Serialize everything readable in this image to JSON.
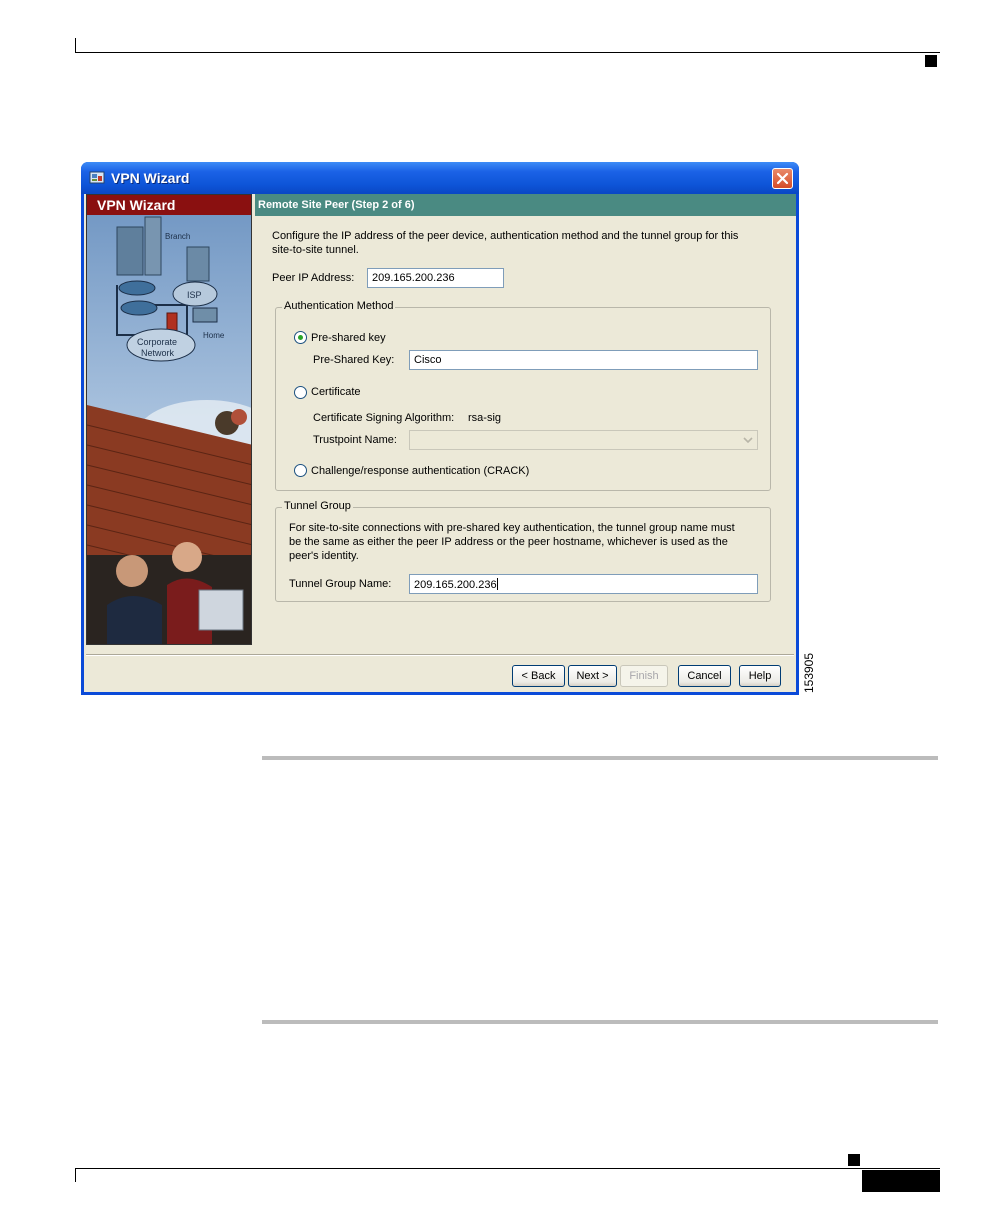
{
  "figure_number": "153905",
  "window": {
    "title": "VPN Wizard",
    "panel_title": "VPN Wizard",
    "step_title": "Remote Site Peer  (Step 2 of 6)"
  },
  "illustration": {
    "labels": {
      "branch": "Branch",
      "isp": "ISP",
      "home": "Home",
      "corporate": "Corporate",
      "network": "Network"
    }
  },
  "form": {
    "intro_line1": "Configure the IP address of the peer device, authentication method and the tunnel group for this",
    "intro_line2": "site-to-site tunnel.",
    "peer_ip_label": "Peer IP Address:",
    "peer_ip_value": "209.165.200.236",
    "auth": {
      "legend": "Authentication Method",
      "preshared_radio_label": "Pre-shared key",
      "preshared_field_label": "Pre-Shared Key:",
      "preshared_field_value": "Cisco",
      "certificate_radio_label": "Certificate",
      "sig_alg_label": "Certificate Signing Algorithm:",
      "sig_alg_value": "rsa-sig",
      "trustpoint_label": "Trustpoint Name:",
      "trustpoint_value": "",
      "crack_radio_label": "Challenge/response authentication (CRACK)",
      "selected": "pre-shared"
    },
    "tunnel": {
      "legend": "Tunnel Group",
      "desc_line1": "For site-to-site connections with pre-shared key authentication, the tunnel group name must",
      "desc_line2": "be the same as either the peer IP address or the peer hostname, whichever is used as the",
      "desc_line3": "peer's identity.",
      "name_label": "Tunnel Group Name:",
      "name_value": "209.165.200.236"
    }
  },
  "buttons": {
    "back": "< Back",
    "next": "Next >",
    "finish": "Finish",
    "cancel": "Cancel",
    "help": "Help"
  },
  "colors": {
    "title_bar": "#0e55d8",
    "panel_header": "#8a1010",
    "step_header": "#4a8a82",
    "dialog_bg": "#ece9d8"
  }
}
